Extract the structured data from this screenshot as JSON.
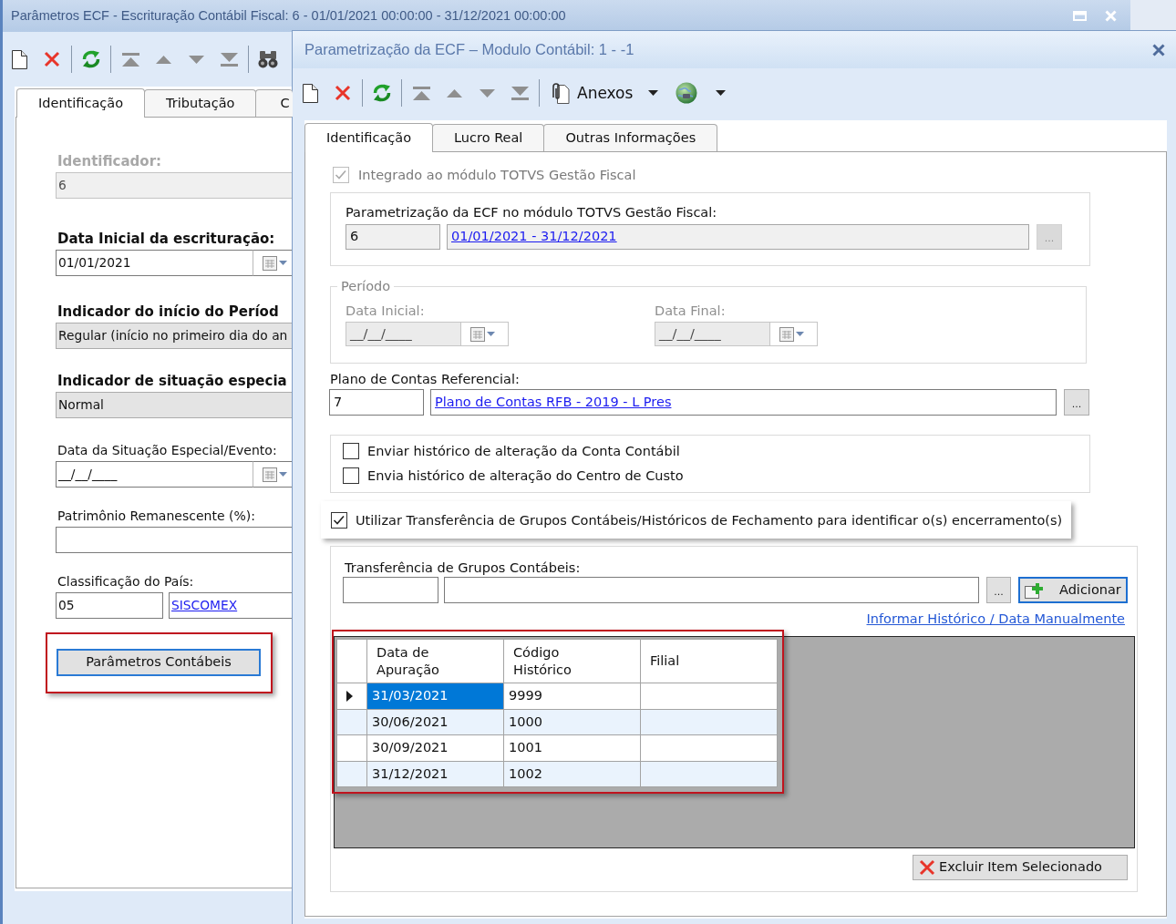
{
  "background_window": {
    "title": "Parâmetros ECF - Escrituração Contábil Fiscal: 6 - 01/01/2021 00:00:00 - 31/12/2021 00:00:00",
    "tabs": [
      {
        "label": "Identificação",
        "selected": true
      },
      {
        "label": "Tributação",
        "selected": false
      },
      {
        "label": "C",
        "selected": false
      }
    ],
    "fields": [
      {
        "kind": "text",
        "label": "Identificador:",
        "required": true,
        "disabled": true,
        "value": "6"
      },
      {
        "kind": "date",
        "label": "Data Inicial da escrituração:",
        "required": true,
        "disabled": false,
        "value": "01/01/2021"
      },
      {
        "kind": "combo",
        "label": "Indicador do início do Períod",
        "required": true,
        "disabled": false,
        "value": "Regular (início no primeiro dia do an"
      },
      {
        "kind": "combo",
        "label": "Indicador de situação especia",
        "required": true,
        "disabled": false,
        "value": "Normal"
      },
      {
        "kind": "date",
        "label": "Data da Situação Especial/Evento:",
        "required": false,
        "disabled": false,
        "value": "__/__/____"
      },
      {
        "kind": "text",
        "label": "Patrimônio Remanescente (%):",
        "required": false,
        "disabled": false
      },
      {
        "kind": "lookup",
        "label": "Classificação do País:",
        "required": false,
        "disabled": false,
        "value": "05",
        "link": "SISCOMEX"
      }
    ],
    "button": {
      "label": "Parâmetros Contábeis",
      "focused": true,
      "highlighted": true
    }
  },
  "dialog": {
    "title": "Parametrização da ECF – Modulo Contábil: 1 - -1",
    "attachments_menu": "Anexos",
    "tabs": [
      {
        "label": "Identificação",
        "selected": true
      },
      {
        "label": "Lucro Real",
        "selected": false
      },
      {
        "label": "Outras Informações",
        "selected": false
      }
    ],
    "integration": {
      "label": "Integrado ao módulo TOTVS Gestão Fiscal",
      "checked": true,
      "disabled": true
    },
    "ecf_parameters": {
      "label": "Parametrização da ECF no módulo TOTVS Gestão Fiscal:",
      "code": "6",
      "link": "01/01/2021 - 31/12/2021",
      "browse": "...",
      "disabled": true
    },
    "period": {
      "title": "Período",
      "disabled": true,
      "dates": [
        {
          "label": "Data Inicial:",
          "value": "__/__/____"
        },
        {
          "label": "Data Final:",
          "value": "__/__/____"
        }
      ]
    },
    "chart_of_accounts": {
      "label": "Plano de Contas Referencial:",
      "code": "7",
      "link": "Plano de Contas RFB - 2019 - L Pres",
      "browse": "...",
      "disabled": false
    },
    "history_options": [
      {
        "label": "Enviar histórico de alteração da Conta Contábil",
        "checked": false
      },
      {
        "label": "Envia histórico de alteração do Centro de Custo",
        "checked": false
      }
    ],
    "closing_transfer": {
      "label": "Utilizar Transferência de Grupos Contábeis/Históricos de Fechamento para identificar o(s) encerramento(s)",
      "checked": true,
      "highlighted": true
    },
    "group_transfer": {
      "label": "Transferência de Grupos Contábeis:",
      "browse": "...",
      "add_button": {
        "label": "Adicionar",
        "focused": true
      },
      "manual_link": "Informar Histórico / Data Manualmente",
      "grid": {
        "highlighted": true,
        "columns": [
          "Data de Apuração",
          "Código Histórico",
          "Filial"
        ],
        "rows": [
          {
            "selected": true,
            "cells": [
              "31/03/2021",
              "9999"
            ]
          },
          {
            "selected": false,
            "cells": [
              "30/06/2021",
              "1000"
            ]
          },
          {
            "selected": false,
            "cells": [
              "30/09/2021",
              "1001"
            ]
          },
          {
            "selected": false,
            "cells": [
              "31/12/2021",
              "1002"
            ]
          }
        ]
      },
      "delete_button": {
        "label": "Excluir Item Selecionado",
        "focused": false
      }
    }
  }
}
